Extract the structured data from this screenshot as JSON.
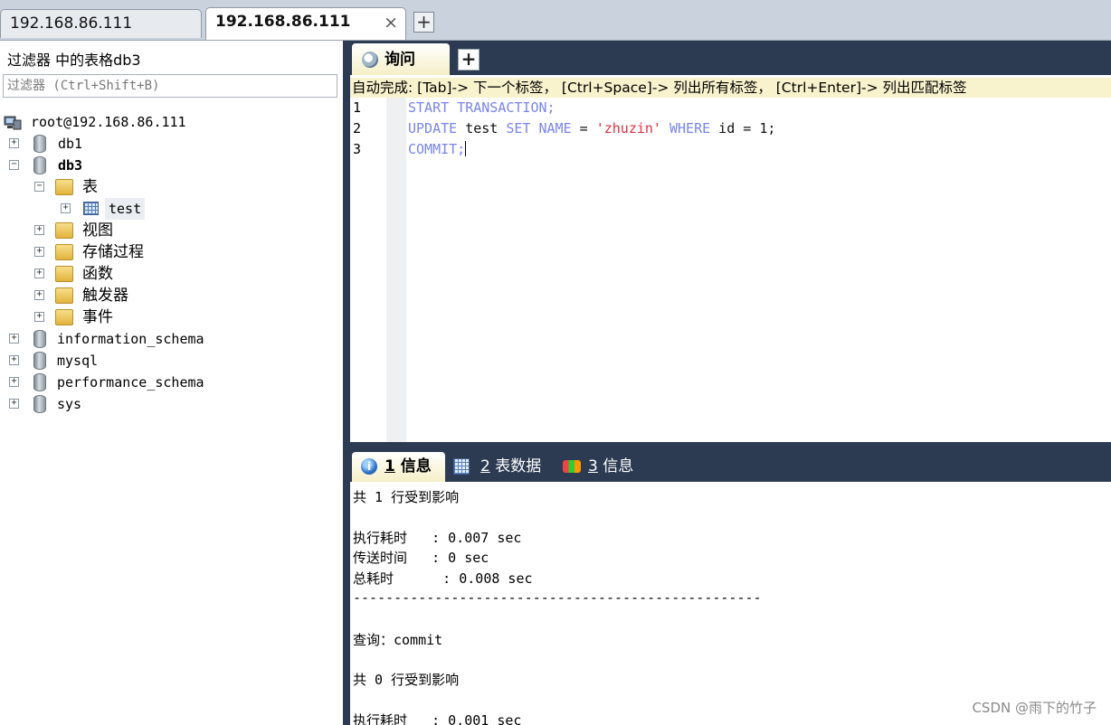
{
  "connection_tabs": [
    {
      "label": "192.168.86.111"
    },
    {
      "label": "192.168.86.111",
      "close": "×"
    }
  ],
  "add_tab_symbol": "+",
  "left_pane": {
    "title": "过滤器 中的表格db3",
    "filter_placeholder": "过滤器 (Ctrl+Shift+B)",
    "tree": {
      "server": "root@192.168.86.111",
      "expand_plus": "+",
      "expand_minus": "−",
      "db1": "db1",
      "db3": "db3",
      "tables": "表",
      "test": "test",
      "views": "视图",
      "procs": "存储过程",
      "functions": "函数",
      "triggers": "触发器",
      "events": "事件",
      "information_schema": "information_schema",
      "mysql": "mysql",
      "performance_schema": "performance_schema",
      "sys": "sys"
    }
  },
  "query_tab": {
    "label": "询问",
    "add": "+"
  },
  "autocomplete_hint": "自动完成: [Tab]-> 下一个标签， [Ctrl+Space]-> 列出所有标签， [Ctrl+Enter]-> 列出匹配标签",
  "editor": {
    "line_numbers": [
      "1",
      "2",
      "3"
    ],
    "line1": "START TRANSACTION;",
    "line2": {
      "kw_update": "UPDATE",
      "table": " test ",
      "kw_set": "SET",
      "space1": " ",
      "col": "NAME",
      "eq": " = ",
      "value": "'zhuzin'",
      "space2": " ",
      "kw_where": "WHERE",
      "cond": " id = 1;"
    },
    "line3": "COMMIT;"
  },
  "result_tabs": [
    {
      "num": "1",
      "label": " 信息"
    },
    {
      "num": "2",
      "label": " 表数据"
    },
    {
      "num": "3",
      "label": " 信息"
    }
  ],
  "results_lines": [
    "共 1 行受到影响",
    "",
    "执行耗时   : 0.007 sec",
    "传送时间   : 0 sec",
    "总耗时      : 0.008 sec",
    "--------------------------------------------------",
    "",
    "查询：commit",
    "",
    "共 0 行受到影响",
    "",
    "执行耗时   : 0.001 sec"
  ],
  "watermark": "CSDN @雨下的竹子",
  "colors": {
    "accent_dark": "#2c3b52",
    "keyword": "#7a84f0",
    "string": "#e0303f",
    "tab_active": "#f5efc7"
  }
}
